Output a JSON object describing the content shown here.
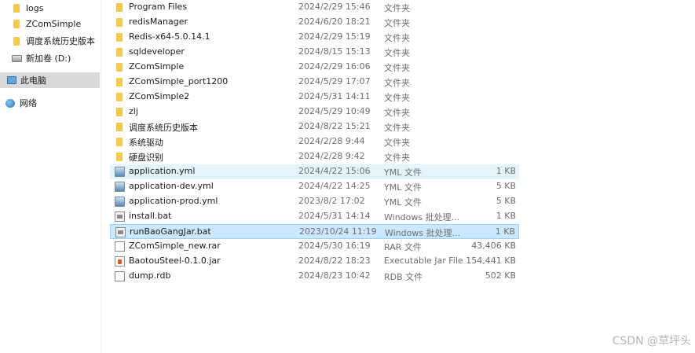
{
  "sidebar": {
    "items": [
      {
        "label": "logs",
        "icon": "folder-icon"
      },
      {
        "label": "ZComSimple",
        "icon": "folder-icon"
      },
      {
        "label": "调度系统历史版本",
        "icon": "folder-icon"
      },
      {
        "label": "新加卷 (D:)",
        "icon": "drive-icon"
      },
      {
        "label": "此电脑",
        "icon": "computer-icon"
      },
      {
        "label": "网络",
        "icon": "network-icon"
      }
    ]
  },
  "files": [
    {
      "name": "Program Files",
      "date": "2024/2/29 15:46",
      "type": "文件夹",
      "size": "",
      "icon": "folder-icon"
    },
    {
      "name": "redisManager",
      "date": "2024/6/20 18:21",
      "type": "文件夹",
      "size": "",
      "icon": "folder-icon"
    },
    {
      "name": "Redis-x64-5.0.14.1",
      "date": "2024/2/29 15:19",
      "type": "文件夹",
      "size": "",
      "icon": "folder-icon"
    },
    {
      "name": "sqldeveloper",
      "date": "2024/8/15 15:13",
      "type": "文件夹",
      "size": "",
      "icon": "folder-icon"
    },
    {
      "name": "ZComSimple",
      "date": "2024/2/29 16:06",
      "type": "文件夹",
      "size": "",
      "icon": "folder-icon"
    },
    {
      "name": "ZComSimple_port1200",
      "date": "2024/5/29 17:07",
      "type": "文件夹",
      "size": "",
      "icon": "folder-icon"
    },
    {
      "name": "ZComSimple2",
      "date": "2024/5/31 14:11",
      "type": "文件夹",
      "size": "",
      "icon": "folder-icon"
    },
    {
      "name": "zlj",
      "date": "2024/5/29 10:49",
      "type": "文件夹",
      "size": "",
      "icon": "folder-icon"
    },
    {
      "name": "调度系统历史版本",
      "date": "2024/8/22 15:21",
      "type": "文件夹",
      "size": "",
      "icon": "folder-icon"
    },
    {
      "name": "系统驱动",
      "date": "2024/2/28 9:44",
      "type": "文件夹",
      "size": "",
      "icon": "folder-icon"
    },
    {
      "name": "硬盘识别",
      "date": "2024/2/28 9:42",
      "type": "文件夹",
      "size": "",
      "icon": "folder-icon"
    },
    {
      "name": "application.yml",
      "date": "2024/4/22 15:06",
      "type": "YML 文件",
      "size": "1 KB",
      "icon": "yml-file-icon"
    },
    {
      "name": "application-dev.yml",
      "date": "2024/4/22 14:25",
      "type": "YML 文件",
      "size": "5 KB",
      "icon": "yml-file-icon"
    },
    {
      "name": "application-prod.yml",
      "date": "2023/8/2 17:02",
      "type": "YML 文件",
      "size": "5 KB",
      "icon": "yml-file-icon"
    },
    {
      "name": "install.bat",
      "date": "2024/5/31 14:14",
      "type": "Windows 批处理...",
      "size": "1 KB",
      "icon": "batch-file-icon"
    },
    {
      "name": "runBaoGangJar.bat",
      "date": "2023/10/24 11:19",
      "type": "Windows 批处理...",
      "size": "1 KB",
      "icon": "batch-file-icon"
    },
    {
      "name": "ZComSimple_new.rar",
      "date": "2024/5/30 16:19",
      "type": "RAR 文件",
      "size": "43,406 KB",
      "icon": "document-icon"
    },
    {
      "name": "BaotouSteel-0.1.0.jar",
      "date": "2024/8/22 18:23",
      "type": "Executable Jar File",
      "size": "154,441 KB",
      "icon": "jar-file-icon"
    },
    {
      "name": "dump.rdb",
      "date": "2024/8/23 10:42",
      "type": "RDB 文件",
      "size": "502 KB",
      "icon": "document-icon"
    }
  ],
  "watermark": "CSDN @草坪头"
}
